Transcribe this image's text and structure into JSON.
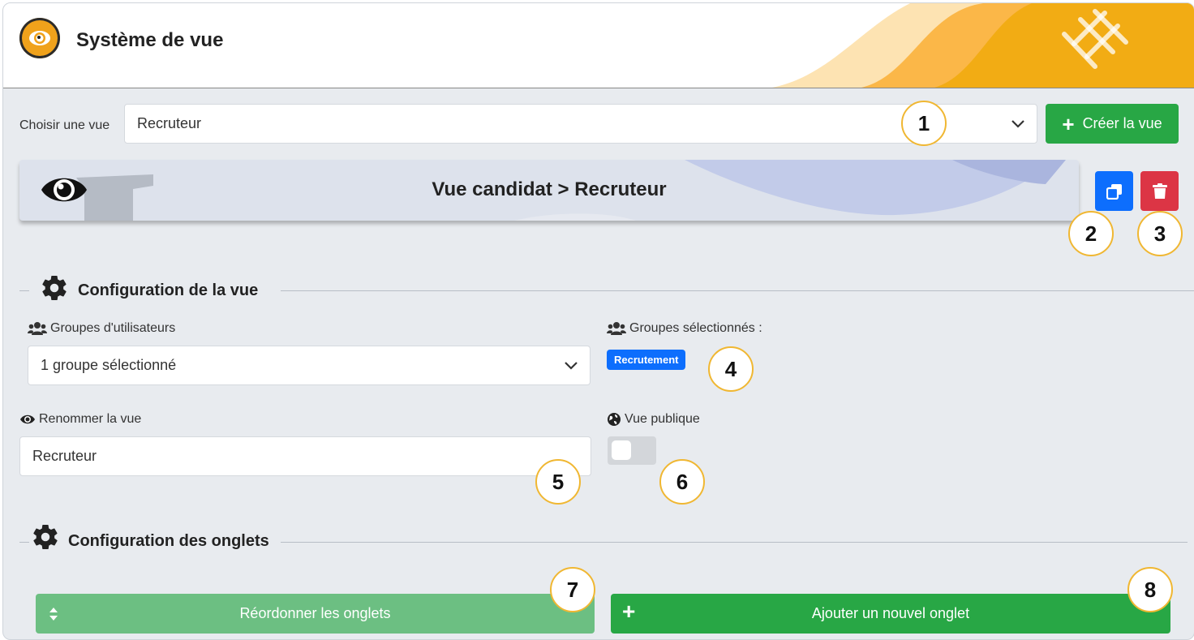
{
  "header": {
    "title": "Système de vue"
  },
  "view_select": {
    "label": "Choisir une vue",
    "value": "Recruteur"
  },
  "create_button": {
    "label": "Créer la vue"
  },
  "banner": {
    "title": "Vue candidat > Recruteur"
  },
  "section_view": {
    "title": "Configuration de la vue"
  },
  "user_groups": {
    "label": "Groupes d'utilisateurs",
    "value": "1 groupe sélectionné"
  },
  "selected_groups": {
    "label": "Groupes sélectionnés :",
    "badges": [
      "Recrutement"
    ]
  },
  "rename": {
    "label": "Renommer la vue",
    "value": "Recruteur"
  },
  "public_view": {
    "label": "Vue publique",
    "enabled": false
  },
  "section_tabs": {
    "title": "Configuration des onglets"
  },
  "reorder_button": {
    "label": "Réordonner les onglets"
  },
  "add_tab_button": {
    "label": "Ajouter un nouvel onglet"
  },
  "callouts": [
    "1",
    "2",
    "3",
    "4",
    "5",
    "6",
    "7",
    "8"
  ],
  "colors": {
    "green": "#28a745",
    "blue": "#0d6efd",
    "red": "#dc3545",
    "callout_border": "#f0b732",
    "accent_orange": "#f0a21b"
  }
}
